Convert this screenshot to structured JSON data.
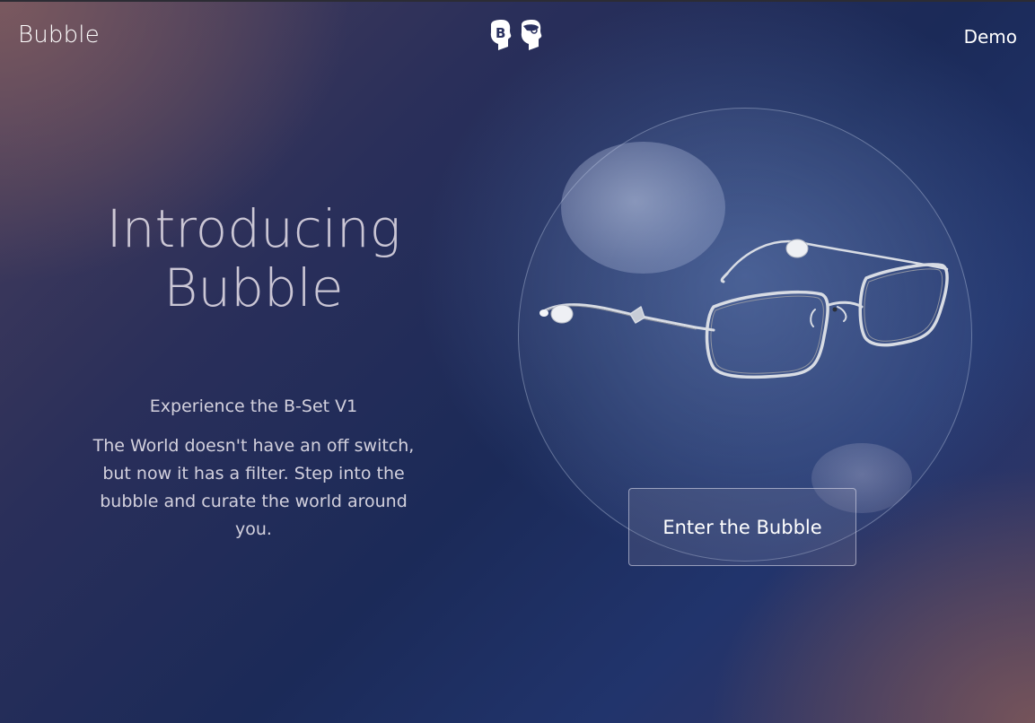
{
  "header": {
    "brand": "Bubble",
    "logo_icon": "bubble-heads-logo-icon",
    "nav_demo": "Demo"
  },
  "hero": {
    "title_line1": "Introducing",
    "title_line2": "Bubble",
    "subtitle": "Experience the B-Set V1",
    "body": "The World doesn't have an off switch, but now it has a filter. Step into the bubble and curate the world around you."
  },
  "product": {
    "image_icon": "eyeglasses-icon",
    "cta_label": "Enter the Bubble"
  },
  "colors": {
    "background_dark": "#1b2a58",
    "accent_rose": "#7d5a5f",
    "text": "#ffffff"
  }
}
